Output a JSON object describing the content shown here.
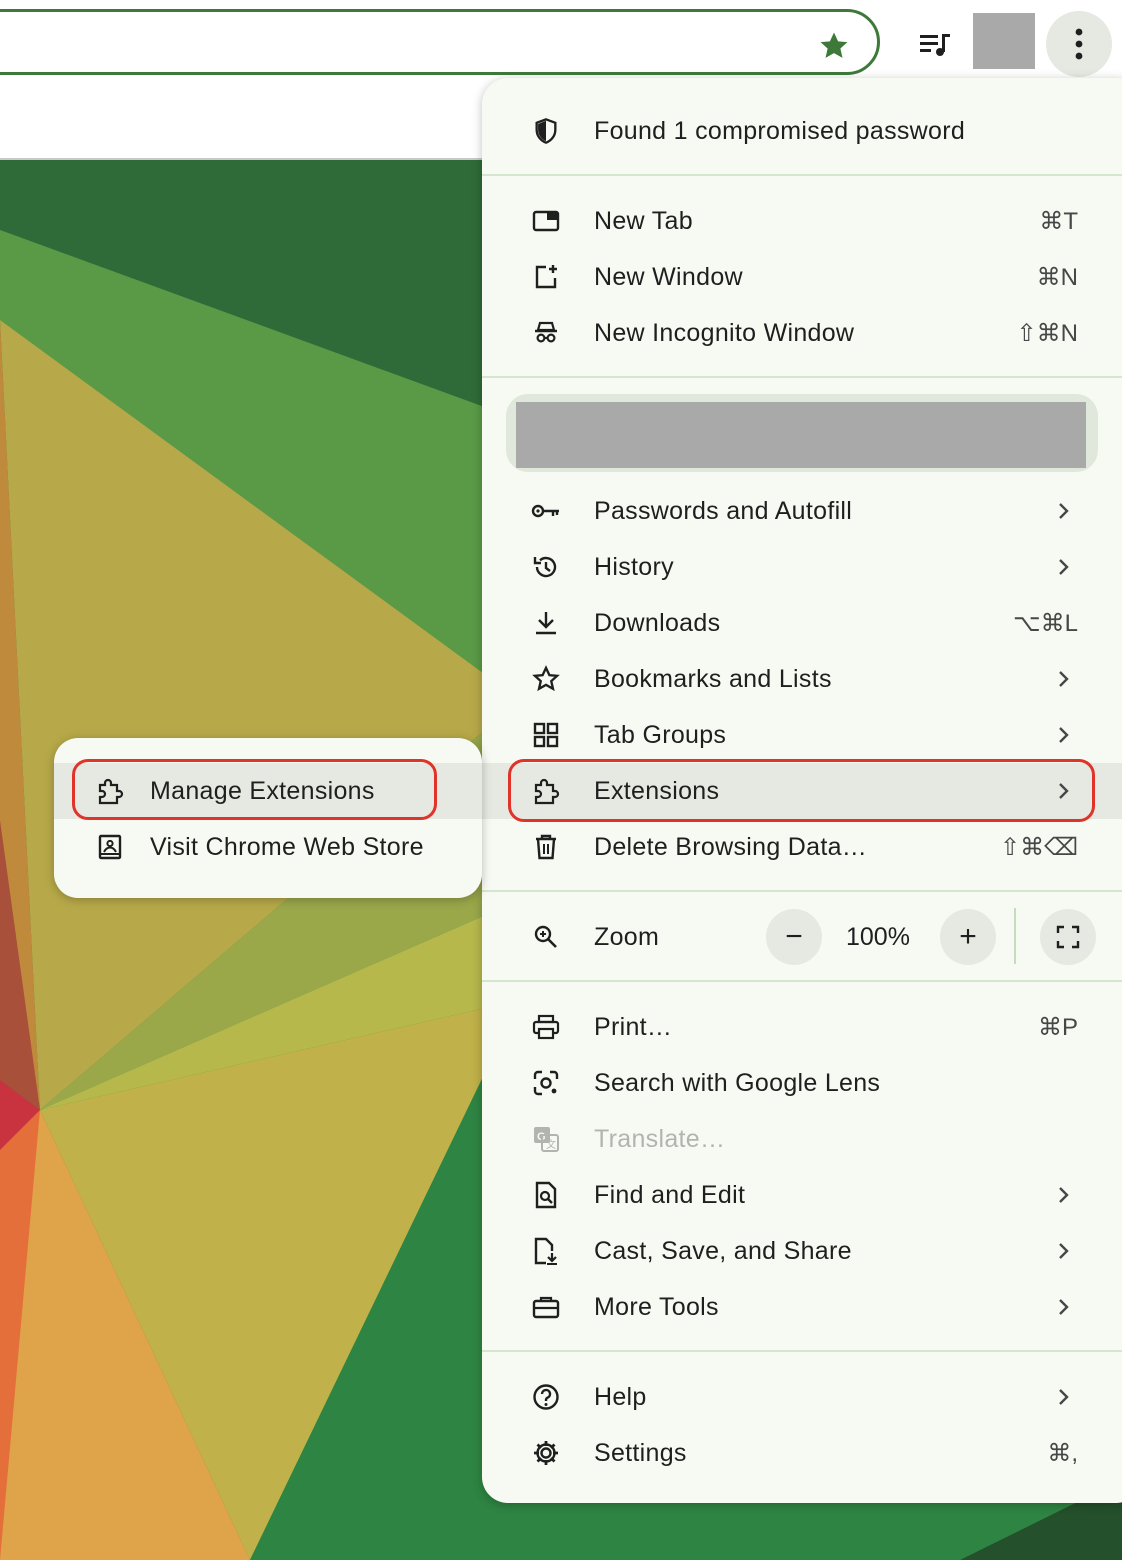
{
  "menu": {
    "password_alert": "Found 1 compromised password",
    "new_tab": {
      "label": "New Tab",
      "shortcut": "⌘T"
    },
    "new_window": {
      "label": "New Window",
      "shortcut": "⌘N"
    },
    "new_incognito": {
      "label": "New Incognito Window",
      "shortcut": "⇧⌘N"
    },
    "passwords": {
      "label": "Passwords and Autofill"
    },
    "history": {
      "label": "History"
    },
    "downloads": {
      "label": "Downloads",
      "shortcut": "⌥⌘L"
    },
    "bookmarks": {
      "label": "Bookmarks and Lists"
    },
    "tab_groups": {
      "label": "Tab Groups"
    },
    "extensions": {
      "label": "Extensions"
    },
    "delete_data": {
      "label": "Delete Browsing Data…",
      "shortcut": "⇧⌘⌫"
    },
    "zoom": {
      "label": "Zoom",
      "value": "100%",
      "minus": "−",
      "plus": "+"
    },
    "print": {
      "label": "Print…",
      "shortcut": "⌘P"
    },
    "lens": {
      "label": "Search with Google Lens"
    },
    "translate": {
      "label": "Translate…"
    },
    "find_edit": {
      "label": "Find and Edit"
    },
    "cast_save": {
      "label": "Cast, Save, and Share"
    },
    "more_tools": {
      "label": "More Tools"
    },
    "help": {
      "label": "Help"
    },
    "settings": {
      "label": "Settings",
      "shortcut": "⌘,"
    }
  },
  "submenu": {
    "manage_extensions": "Manage Extensions",
    "visit_store": "Visit Chrome Web Store"
  },
  "colors": {
    "accent_green": "#3d7a3a",
    "highlight_outline": "#e0332a",
    "menu_background": "#f7faf3"
  }
}
